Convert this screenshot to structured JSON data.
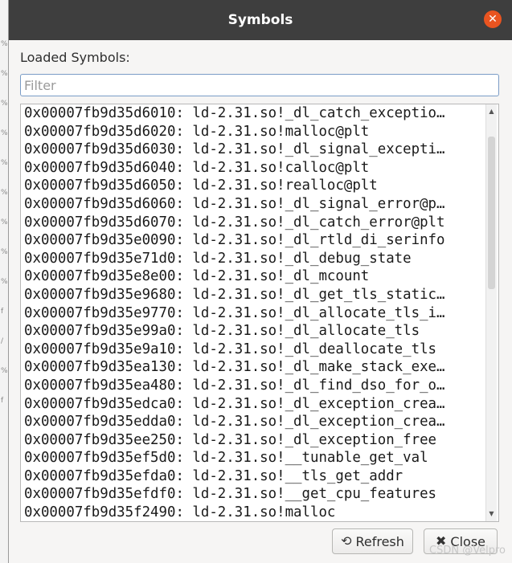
{
  "background_strip": [
    "%",
    "%",
    "%",
    "%",
    "%",
    "%",
    "%",
    "%",
    "%",
    "f",
    "/",
    "%",
    "f"
  ],
  "dialog": {
    "title": "Symbols",
    "close_icon": "close-icon",
    "loaded_label": "Loaded Symbols:",
    "filter_placeholder": "Filter",
    "symbols": [
      "0x00007fb9d35d6010: ld-2.31.so!_dl_catch_exceptio…",
      "0x00007fb9d35d6020: ld-2.31.so!malloc@plt",
      "0x00007fb9d35d6030: ld-2.31.so!_dl_signal_excepti…",
      "0x00007fb9d35d6040: ld-2.31.so!calloc@plt",
      "0x00007fb9d35d6050: ld-2.31.so!realloc@plt",
      "0x00007fb9d35d6060: ld-2.31.so!_dl_signal_error@p…",
      "0x00007fb9d35d6070: ld-2.31.so!_dl_catch_error@plt",
      "0x00007fb9d35e0090: ld-2.31.so!_dl_rtld_di_serinfo",
      "0x00007fb9d35e71d0: ld-2.31.so!_dl_debug_state",
      "0x00007fb9d35e8e00: ld-2.31.so!_dl_mcount",
      "0x00007fb9d35e9680: ld-2.31.so!_dl_get_tls_static…",
      "0x00007fb9d35e9770: ld-2.31.so!_dl_allocate_tls_i…",
      "0x00007fb9d35e99a0: ld-2.31.so!_dl_allocate_tls",
      "0x00007fb9d35e9a10: ld-2.31.so!_dl_deallocate_tls",
      "0x00007fb9d35ea130: ld-2.31.so!_dl_make_stack_exe…",
      "0x00007fb9d35ea480: ld-2.31.so!_dl_find_dso_for_o…",
      "0x00007fb9d35edca0: ld-2.31.so!_dl_exception_crea…",
      "0x00007fb9d35edda0: ld-2.31.so!_dl_exception_crea…",
      "0x00007fb9d35ee250: ld-2.31.so!_dl_exception_free",
      "0x00007fb9d35ef5d0: ld-2.31.so!__tunable_get_val",
      "0x00007fb9d35efda0: ld-2.31.so!__tls_get_addr",
      "0x00007fb9d35efdf0: ld-2.31.so!__get_cpu_features",
      "0x00007fb9d35f2490: ld-2.31.so!malloc"
    ],
    "refresh_label": "Refresh",
    "refresh_icon": "refresh-icon",
    "close_label": "Close",
    "close_button_icon": "close-icon"
  },
  "watermark": "CSDN @Velpro",
  "colors": {
    "titlebar": "#3e3e3e",
    "close_accent": "#e95420",
    "filter_border": "#7a9cc6"
  }
}
